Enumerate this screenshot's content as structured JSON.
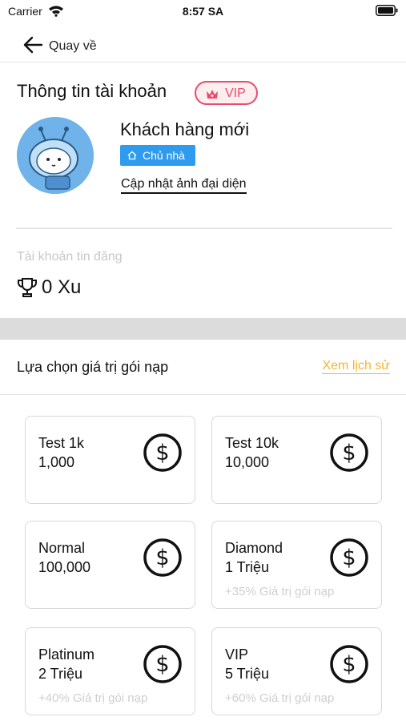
{
  "status_bar": {
    "carrier": "Carrier",
    "time": "8:57 SA"
  },
  "nav": {
    "back_label": "Quay về"
  },
  "account": {
    "title": "Thông tin tài khoản",
    "vip_label": "VIP",
    "user_name": "Khách hàng mới",
    "role": "Chủ nhà",
    "update_avatar": "Cập nhật ảnh đại diện",
    "account_type_label": "Tài khoản tin đăng",
    "coin_balance": "0 Xu"
  },
  "topup": {
    "title": "Lựa chọn giá trị gói nạp",
    "history_link": "Xem lịch sử",
    "packages": [
      {
        "name": "Test 1k",
        "amount": "1,000",
        "bonus": ""
      },
      {
        "name": "Test 10k",
        "amount": "10,000",
        "bonus": ""
      },
      {
        "name": "Normal",
        "amount": "100,000",
        "bonus": ""
      },
      {
        "name": "Diamond",
        "amount": "1 Triệu",
        "bonus": "+35% Giá trị gói nạp"
      },
      {
        "name": "Platinum",
        "amount": "2 Triệu",
        "bonus": "+40% Giá trị gói nạp"
      },
      {
        "name": "VIP",
        "amount": "5 Triệu",
        "bonus": "+60% Giá trị gói nạp"
      }
    ]
  },
  "colors": {
    "vip": "#e94b6b",
    "role_badge": "#2f9bee",
    "history_link": "#f4b52a",
    "avatar_bg": "#6fb3ea"
  },
  "icons": {
    "status": [
      "wifi-icon",
      "battery-icon"
    ],
    "nav": "back-arrow-icon",
    "vip": "crown-icon",
    "role": "home-icon",
    "balance": "trophy-icon",
    "package": "dollar-icon"
  }
}
